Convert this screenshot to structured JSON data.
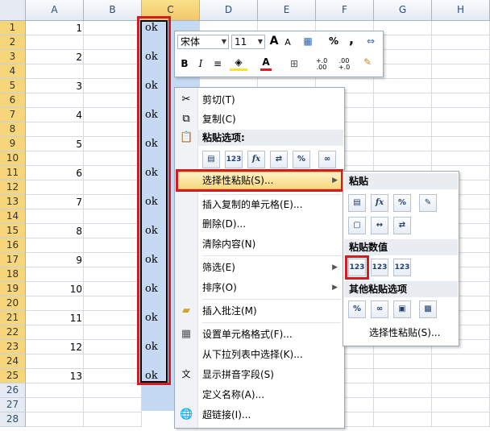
{
  "columns": [
    "A",
    "B",
    "C",
    "D",
    "E",
    "F",
    "G",
    "H"
  ],
  "rows": [
    "1",
    "2",
    "3",
    "4",
    "5",
    "6",
    "7",
    "8",
    "9",
    "10",
    "11",
    "12",
    "13",
    "14",
    "15",
    "16",
    "17",
    "18",
    "19",
    "20",
    "21",
    "22",
    "23",
    "24",
    "25",
    "26",
    "27",
    "28"
  ],
  "col_a_values": [
    "1",
    "2",
    "3",
    "4",
    "5",
    "6",
    "7",
    "8",
    "9",
    "10",
    "11",
    "12",
    "13"
  ],
  "col_c_value": "ok",
  "mini_toolbar": {
    "font_name": "宋体",
    "font_size": "11",
    "grow_font": "A",
    "shrink_font": "A",
    "percent": "%",
    "comma": ",",
    "bold": "B",
    "italic": "I",
    "font_color_letter": "A",
    "inc_decimal": "+.0 .00",
    "dec_decimal": ".00 +.0"
  },
  "context_menu": {
    "cut": "剪切(T)",
    "copy": "复制(C)",
    "paste_options_title": "粘贴选项:",
    "paste_special": "选择性粘贴(S)...",
    "insert_copied": "插入复制的单元格(E)...",
    "delete": "删除(D)...",
    "clear_contents": "清除内容(N)",
    "filter": "筛选(E)",
    "sort": "排序(O)",
    "insert_comment": "插入批注(M)",
    "format_cells": "设置单元格格式(F)...",
    "pick_from_list": "从下拉列表中选择(K)...",
    "show_phonetic": "显示拼音字段(S)",
    "define_name": "定义名称(A)...",
    "hyperlink": "超链接(I)..."
  },
  "paste_icon_labels": {
    "values": "123",
    "formula": "fx",
    "percent_format": "%"
  },
  "submenu": {
    "paste_title": "粘贴",
    "paste_values_title": "粘贴数值",
    "other_title": "其他粘贴选项",
    "paste_special": "选择性粘贴(S)...",
    "values_icons": [
      "123",
      "123",
      "123"
    ]
  }
}
